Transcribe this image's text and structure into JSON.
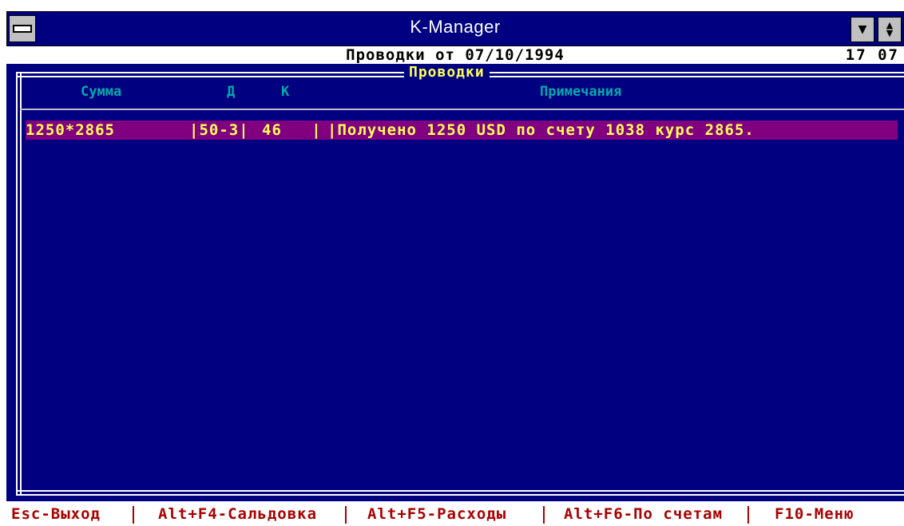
{
  "window": {
    "title": "K-Manager"
  },
  "infoline": {
    "caption": "Проводки от 07/10/1994",
    "time": "17 07"
  },
  "panel": {
    "title": "Проводки",
    "columns": {
      "sum": "Сумма",
      "debit": "Д",
      "credit": "К",
      "notes": "Примечания"
    },
    "rows": [
      {
        "sum": "1250*2865",
        "debit": "|50-3|",
        "credit": "46   |",
        "note": "|Получено 1250 USD по счету 1038 курс 2865."
      }
    ]
  },
  "fkeys": [
    {
      "label": "Esc-Выход"
    },
    {
      "label": "Alt+F4-Сальдовка"
    },
    {
      "label": "Alt+F5-Расходы"
    },
    {
      "label": "Alt+F6-По счетам"
    },
    {
      "label": "F10-Меню"
    }
  ],
  "colors": {
    "background": "#000080",
    "highlight_row": "#800080",
    "row_text": "#ffff55",
    "column_header": "#00aaaa",
    "fkey_text": "#aa0000"
  }
}
